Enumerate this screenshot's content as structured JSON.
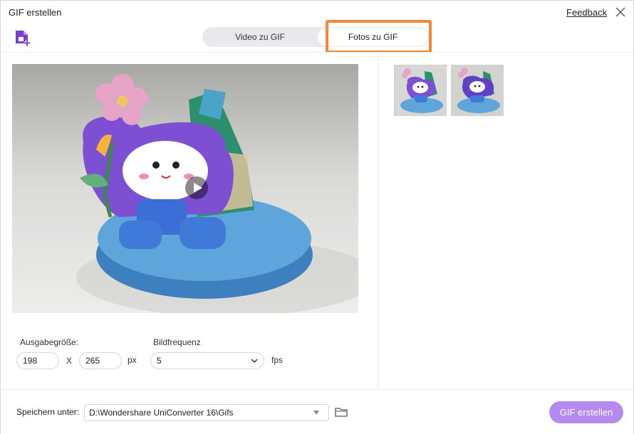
{
  "window": {
    "title": "GIF erstellen",
    "feedback_label": "Feedback"
  },
  "icons": {
    "close": "close-icon",
    "add_file": "add-file-icon",
    "play": "play-icon",
    "folder": "folder-icon",
    "dropdown": "chevron-down-icon"
  },
  "tabs": {
    "video_label": "Video zu GIF",
    "photos_label": "Fotos zu GIF",
    "active": "Fotos zu GIF"
  },
  "settings": {
    "output_size_label": "Ausgabegröße:",
    "width_value": "198",
    "separator": "X",
    "height_value": "265",
    "size_unit": "px",
    "frame_rate_label": "Bildfrequenz",
    "frame_rate_value": "5",
    "frame_rate_unit": "fps"
  },
  "thumbnails": [
    {
      "name": "photo-1"
    },
    {
      "name": "photo-2"
    }
  ],
  "footer": {
    "save_label": "Speichern unter:",
    "save_path": "D:\\Wondershare UniConverter 16\\Gifs",
    "create_label": "GIF erstellen"
  },
  "colors": {
    "accent": "#b58af0",
    "highlight": "#f58634",
    "brand_icon": "#7a3fd1"
  }
}
